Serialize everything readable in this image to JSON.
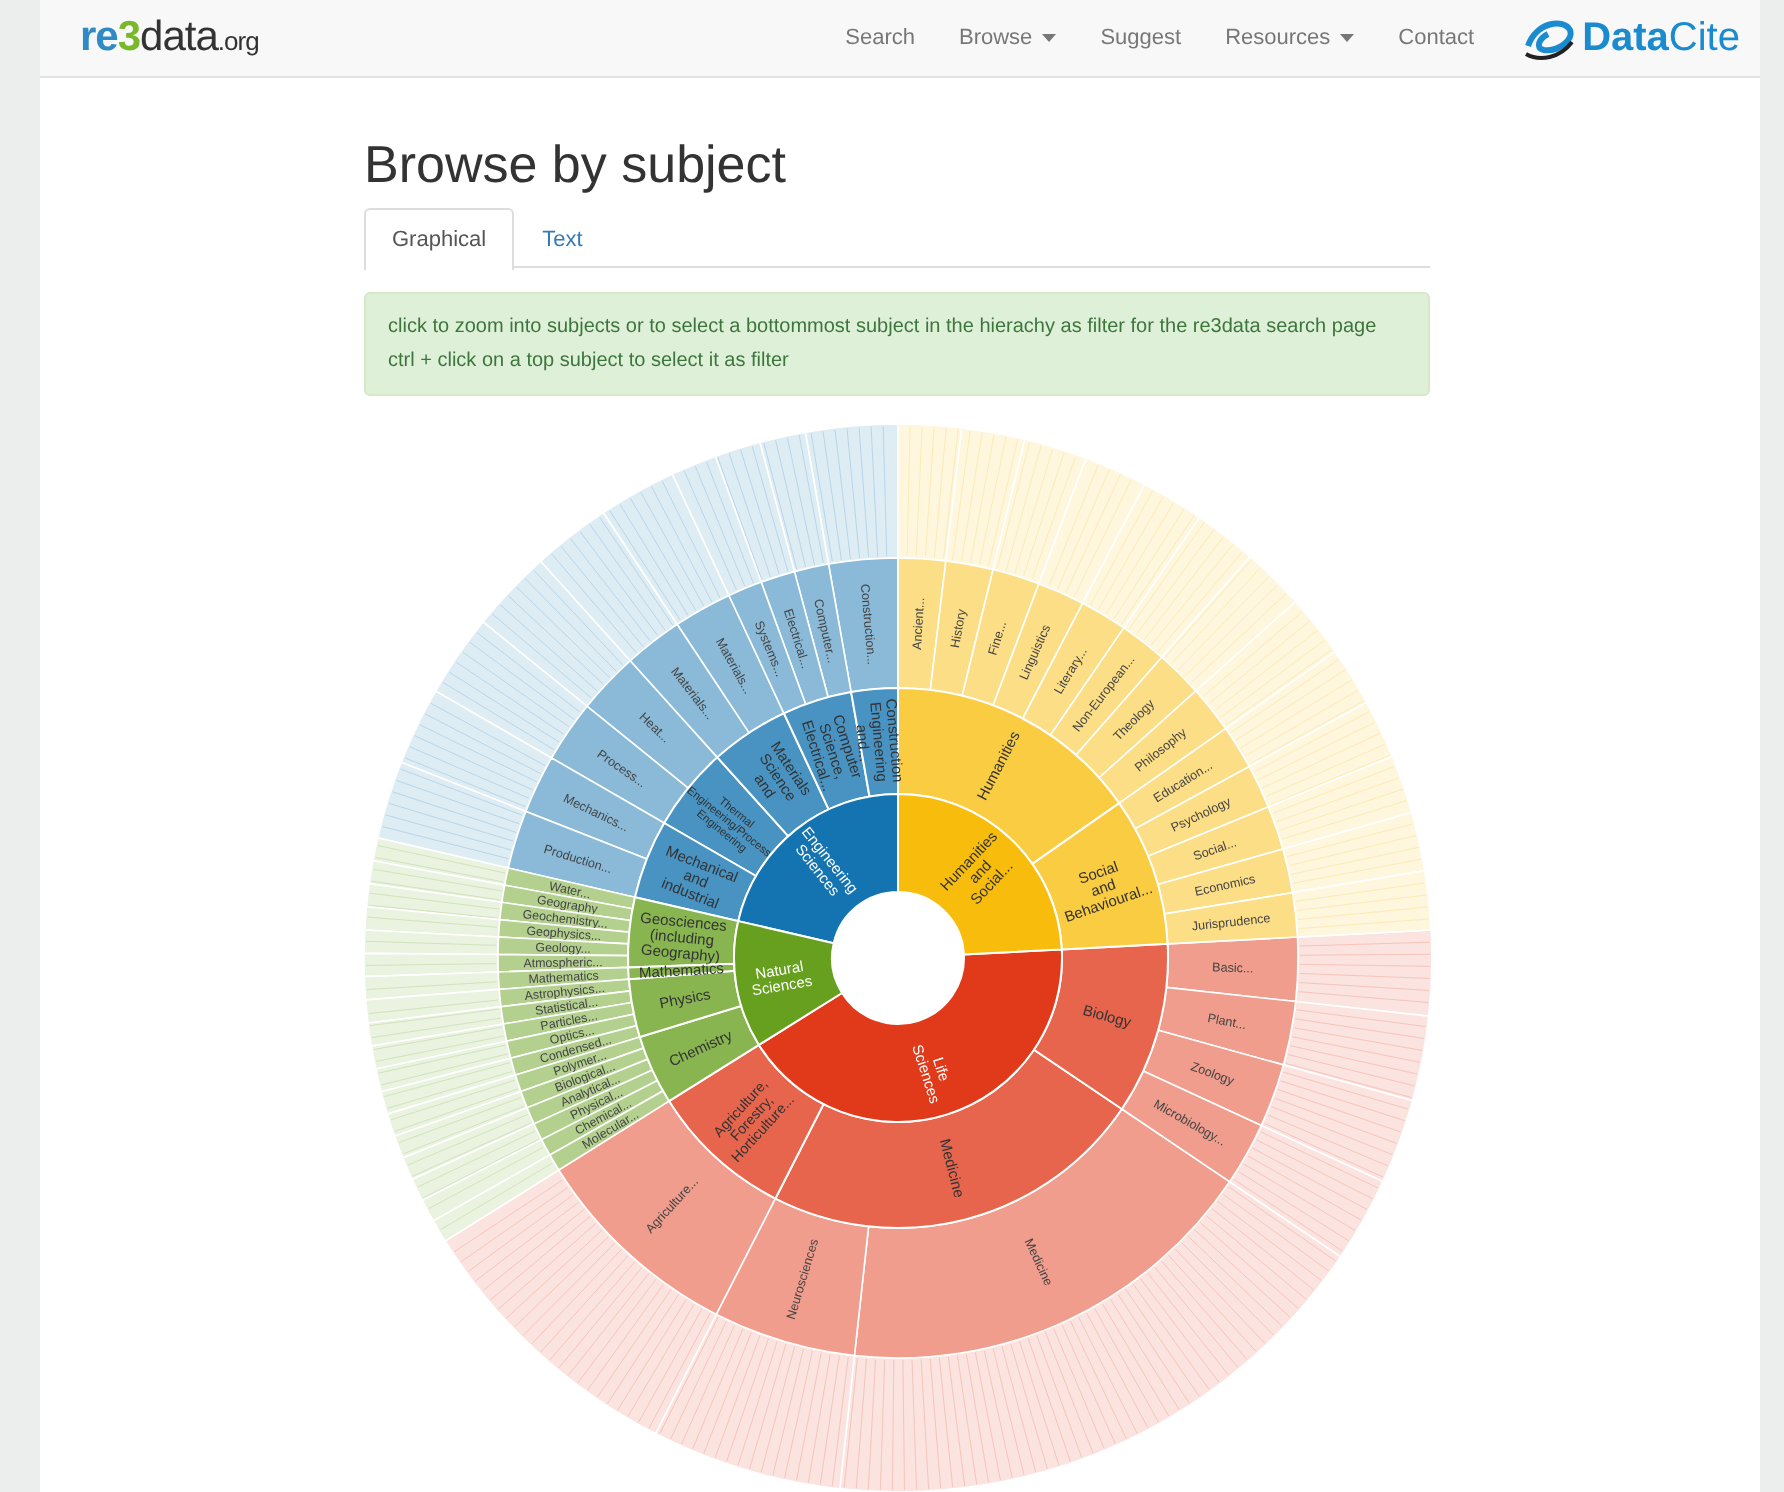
{
  "navbar": {
    "logo": [
      "re",
      "3",
      "data",
      ".org"
    ],
    "items": [
      {
        "label": "Search",
        "dropdown": false
      },
      {
        "label": "Browse",
        "dropdown": true
      },
      {
        "label": "Suggest",
        "dropdown": false
      },
      {
        "label": "Resources",
        "dropdown": true
      },
      {
        "label": "Contact",
        "dropdown": false
      }
    ],
    "partner_logo": [
      "Data",
      "Cite"
    ]
  },
  "title": "Browse by subject",
  "tabs": [
    {
      "label": "Graphical",
      "selected": true
    },
    {
      "label": "Text",
      "selected": false
    }
  ],
  "hint": [
    "click to zoom into subjects or to select a bottommost subject in the hierachy as filter for the re3data search page",
    "ctrl + click on a top subject to select it as filter"
  ],
  "sunburst": {
    "subjects": [
      {
        "label": "Engineering Sciences",
        "color": "#1474b1",
        "children": [
          {
            "label": "Construction Engineering and...",
            "children": [
              {
                "label": "Construction..."
              }
            ]
          },
          {
            "label": "Computer Science, Electrical...",
            "children": [
              {
                "label": "Computer..."
              },
              {
                "label": "Electrical..."
              },
              {
                "label": "Systems..."
              }
            ]
          },
          {
            "label": "Materials Science and",
            "children": [
              {
                "label": "Materials..."
              },
              {
                "label": "Materials..."
              }
            ]
          },
          {
            "label": "Thermal Engineering/Process Engineering",
            "children": [
              {
                "label": "Heat..."
              },
              {
                "label": "Process..."
              }
            ]
          },
          {
            "label": "Mechanical and industrial",
            "children": [
              {
                "label": "Mechanics..."
              },
              {
                "label": "Production..."
              }
            ]
          }
        ]
      },
      {
        "label": "Humanities and Social...",
        "color": "#f8bd0c",
        "children": [
          {
            "label": "Humanities",
            "children": [
              {
                "label": "Ancient..."
              },
              {
                "label": "History"
              },
              {
                "label": "Fine..."
              },
              {
                "label": "Linguistics"
              },
              {
                "label": "Literary..."
              },
              {
                "label": "Non-European..."
              },
              {
                "label": "Theology"
              },
              {
                "label": "Philosophy"
              }
            ]
          },
          {
            "label": "Social and Behavioural...",
            "children": [
              {
                "label": "Education..."
              },
              {
                "label": "Psychology"
              },
              {
                "label": "Social..."
              },
              {
                "label": "Economics"
              },
              {
                "label": "Jurisprudence"
              }
            ]
          }
        ]
      },
      {
        "label": "Life Sciences",
        "color": "#e03a1b",
        "children": [
          {
            "label": "Biology",
            "children": [
              {
                "label": "Basic..."
              },
              {
                "label": "Plant..."
              },
              {
                "label": "Zoology"
              },
              {
                "label": "Microbiology..."
              }
            ]
          },
          {
            "label": "Medicine",
            "children": [
              {
                "label": "Medicine"
              },
              {
                "label": "Neurosciences"
              }
            ]
          },
          {
            "label": "Agriculture, Forestry, Horticulture...",
            "children": [
              {
                "label": "Agriculture..."
              }
            ]
          }
        ]
      },
      {
        "label": "Natural Sciences",
        "color": "#67a01e",
        "children": [
          {
            "label": "Geosciences (including Geography)",
            "children": [
              {
                "label": "Water..."
              },
              {
                "label": "Geography"
              },
              {
                "label": "Geochemistry..."
              },
              {
                "label": "Geophysics..."
              },
              {
                "label": "Geology..."
              },
              {
                "label": "Atmospheric..."
              }
            ]
          },
          {
            "label": "Mathematics",
            "children": [
              {
                "label": "Mathematics"
              }
            ]
          },
          {
            "label": "Physics",
            "children": [
              {
                "label": "Astrophysics..."
              },
              {
                "label": "Statistical..."
              },
              {
                "label": "Particles..."
              },
              {
                "label": "Optics..."
              },
              {
                "label": "Condensed..."
              }
            ]
          },
          {
            "label": "Chemistry",
            "children": [
              {
                "label": "Polymer..."
              },
              {
                "label": "Biological..."
              },
              {
                "label": "Analytical..."
              },
              {
                "label": "Physical..."
              },
              {
                "label": "Chemical..."
              },
              {
                "label": "Molecular..."
              }
            ]
          }
        ]
      }
    ]
  }
}
